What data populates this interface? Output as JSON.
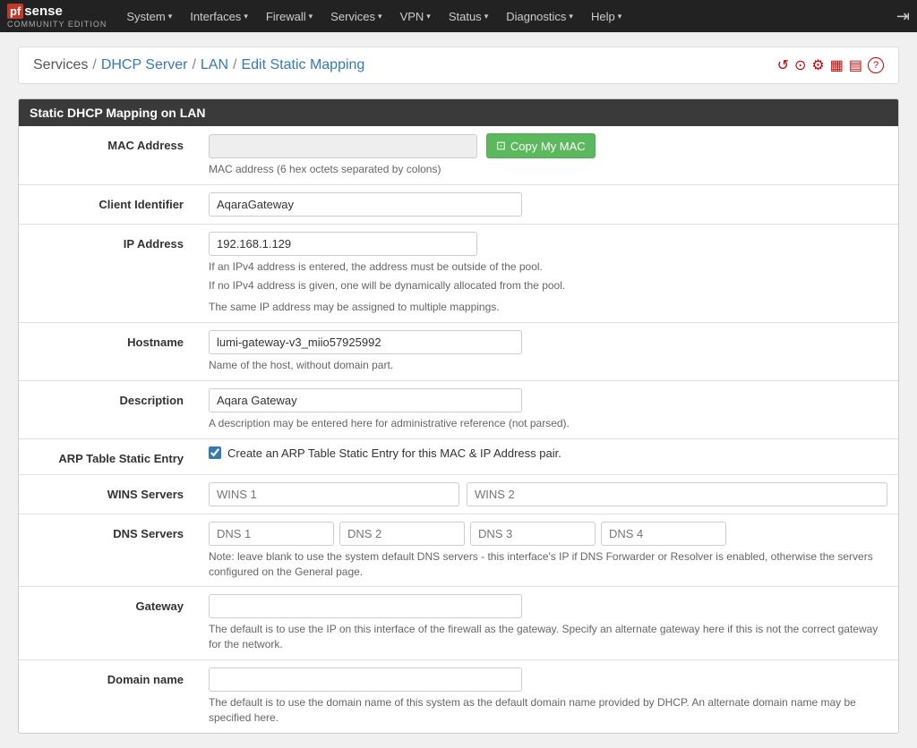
{
  "navbar": {
    "brand": "pfSense",
    "brand_sub": "COMMUNITY EDITION",
    "items": [
      {
        "label": "System",
        "id": "system"
      },
      {
        "label": "Interfaces",
        "id": "interfaces"
      },
      {
        "label": "Firewall",
        "id": "firewall"
      },
      {
        "label": "Services",
        "id": "services"
      },
      {
        "label": "VPN",
        "id": "vpn"
      },
      {
        "label": "Status",
        "id": "status"
      },
      {
        "label": "Diagnostics",
        "id": "diagnostics"
      },
      {
        "label": "Help",
        "id": "help"
      }
    ]
  },
  "breadcrumb": {
    "services": "Services",
    "sep1": "/",
    "dhcp": "DHCP Server",
    "sep2": "/",
    "lan": "LAN",
    "sep3": "/",
    "edit": "Edit Static Mapping"
  },
  "section_title": "Static DHCP Mapping on LAN",
  "form": {
    "mac_address": {
      "label": "MAC Address",
      "value": "",
      "placeholder": "",
      "copy_button": "Copy My MAC",
      "help": "MAC address (6 hex octets separated by colons)"
    },
    "client_identifier": {
      "label": "Client Identifier",
      "value": "AqaraGateway",
      "placeholder": ""
    },
    "ip_address": {
      "label": "IP Address",
      "value": "192.168.1.129",
      "placeholder": "",
      "help1": "If an IPv4 address is entered, the address must be outside of the pool.",
      "help2": "If no IPv4 address is given, one will be dynamically allocated from the pool.",
      "help3": "The same IP address may be assigned to multiple mappings."
    },
    "hostname": {
      "label": "Hostname",
      "value": "lumi-gateway-v3_miio57925992",
      "placeholder": "",
      "help": "Name of the host, without domain part."
    },
    "description": {
      "label": "Description",
      "value": "Aqara Gateway",
      "placeholder": "",
      "help": "A description may be entered here for administrative reference (not parsed)."
    },
    "arp_table": {
      "label": "ARP Table Static Entry",
      "checked": true,
      "checkbox_label": "Create an ARP Table Static Entry for this MAC & IP Address pair."
    },
    "wins_servers": {
      "label": "WINS Servers",
      "wins1_placeholder": "WINS 1",
      "wins2_placeholder": "WINS 2"
    },
    "dns_servers": {
      "label": "DNS Servers",
      "dns1_placeholder": "DNS 1",
      "dns2_placeholder": "DNS 2",
      "dns3_placeholder": "DNS 3",
      "dns4_placeholder": "DNS 4",
      "help": "Note: leave blank to use the system default DNS servers - this interface's IP if DNS Forwarder or Resolver is enabled, otherwise the servers configured on the General page."
    },
    "gateway": {
      "label": "Gateway",
      "value": "",
      "placeholder": "",
      "help": "The default is to use the IP on this interface of the firewall as the gateway. Specify an alternate gateway here if this is not the correct gateway for the network."
    },
    "domain_name": {
      "label": "Domain name",
      "value": "",
      "placeholder": "",
      "help": "The default is to use the domain name of this system as the default domain name provided by DHCP. An alternate domain name may be specified here."
    }
  },
  "icons": {
    "reload": "↺",
    "circle": "⊙",
    "list": "≡",
    "chart": "▦",
    "table": "▤",
    "help": "?"
  }
}
